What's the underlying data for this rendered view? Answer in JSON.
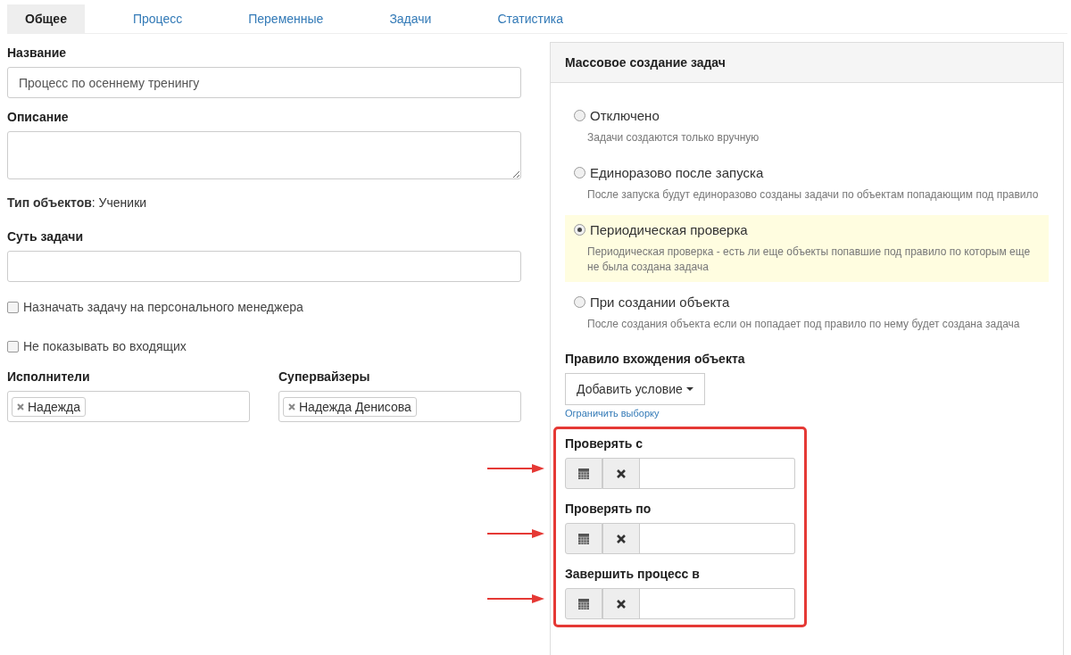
{
  "tabs": [
    {
      "label": "Общее",
      "selected": true
    },
    {
      "label": "Процесс",
      "selected": false
    },
    {
      "label": "Переменные",
      "selected": false
    },
    {
      "label": "Задачи",
      "selected": false
    },
    {
      "label": "Статистика",
      "selected": false
    }
  ],
  "name_field": {
    "label": "Название",
    "value": "Процесс по осеннему тренингу"
  },
  "description_field": {
    "label": "Описание"
  },
  "object_type": "**Тип объектов**: Ученики",
  "task_essence_field": {
    "label": "Суть задачи"
  },
  "checkboxes": [
    {
      "label": "Назначать задачу на персонального менеджера",
      "checked": false
    },
    {
      "label": "Не показывать во входящих",
      "checked": false
    }
  ],
  "people": [
    {
      "label": "Исполнители",
      "tags": [
        "Надежда"
      ]
    },
    {
      "label": "Супервайзеры",
      "tags": [
        "Надежда Денисова"
      ]
    }
  ],
  "panel": {
    "title": "Массовое создание задач",
    "options": [
      {
        "label": "Отключено",
        "description": "Задачи создаются только вручную",
        "selected": false
      },
      {
        "label": "Единоразово после запуска",
        "description": "После запуска будут единоразово созданы задачи по объектам попадающим под правило",
        "selected": false
      },
      {
        "label": "Периодическая проверка",
        "description": "Периодическая проверка - есть ли еще объекты попавшие под правило по которым еще не была создана задача",
        "selected": true
      },
      {
        "label": "При создании объекта",
        "description": "После создания объекта если он попадает под правило по нему будет создана задача",
        "selected": false
      }
    ],
    "rule_label": "Правило вхождения объекта",
    "add_condition_button": "Добавить условие",
    "limit_link": "Ограничить выборку",
    "date_fields": [
      {
        "label": "Проверять с"
      },
      {
        "label": "Проверять по"
      },
      {
        "label": "Завершить процесс в"
      }
    ]
  }
}
